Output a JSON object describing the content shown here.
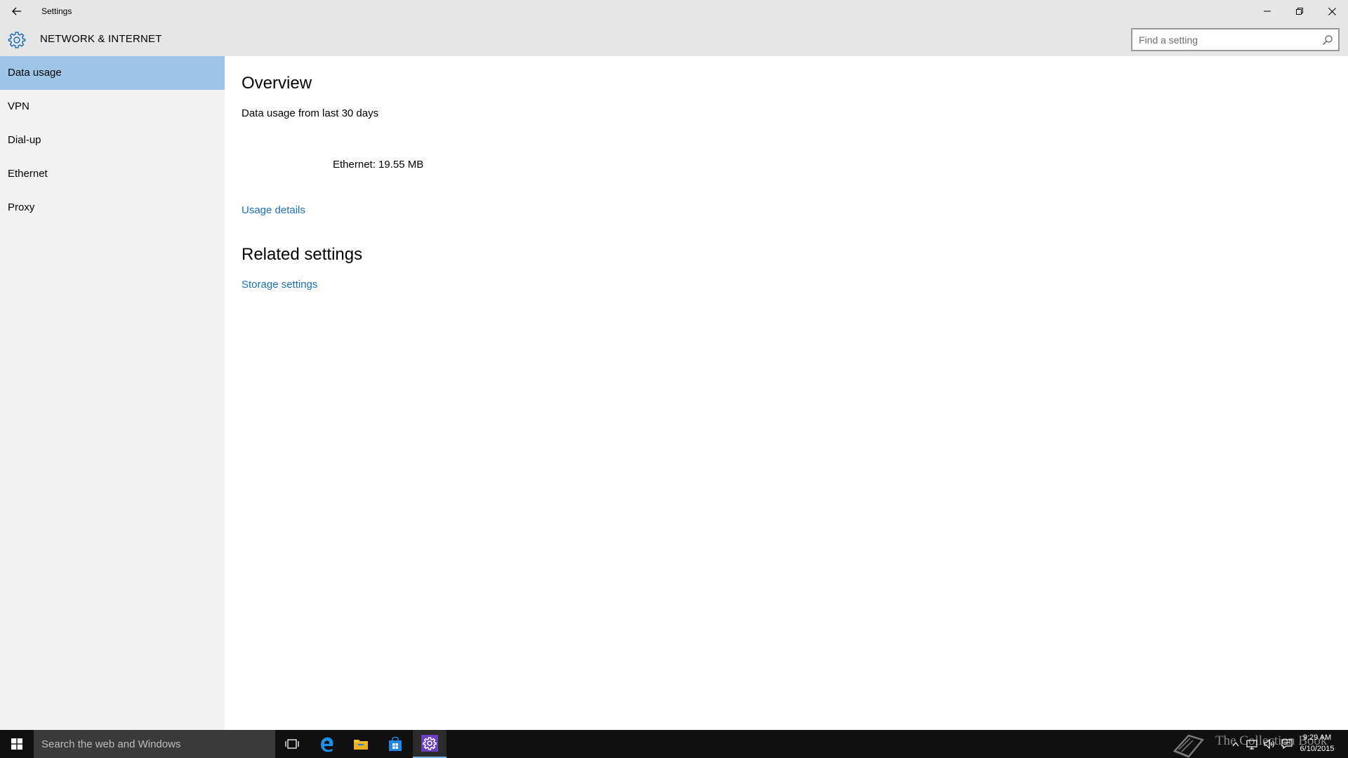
{
  "window": {
    "title": "Settings"
  },
  "header": {
    "title": "NETWORK & INTERNET",
    "search_placeholder": "Find a setting"
  },
  "sidebar": {
    "items": [
      {
        "label": "Data usage",
        "active": true
      },
      {
        "label": "VPN",
        "active": false
      },
      {
        "label": "Dial-up",
        "active": false
      },
      {
        "label": "Ethernet",
        "active": false
      },
      {
        "label": "Proxy",
        "active": false
      }
    ]
  },
  "main": {
    "overview_heading": "Overview",
    "range_text": "Data usage from last 30 days",
    "usage_text": "Ethernet: 19.55 MB",
    "usage_details_link": "Usage details",
    "related_heading": "Related settings",
    "storage_link": "Storage settings"
  },
  "taskbar": {
    "search_placeholder": "Search the web and Windows",
    "apps": [
      "task-view-icon",
      "edge-icon",
      "file-explorer-icon",
      "store-icon",
      "settings-icon"
    ],
    "watermark_text": "The Collection Book",
    "time": "9:29 AM",
    "date": "6/10/2015"
  },
  "colors": {
    "accent": "#1a6fb8",
    "selection": "#9ec6e8",
    "chrome": "#e6e6e6",
    "sidebar": "#f2f2f2",
    "taskbar": "#101010"
  }
}
